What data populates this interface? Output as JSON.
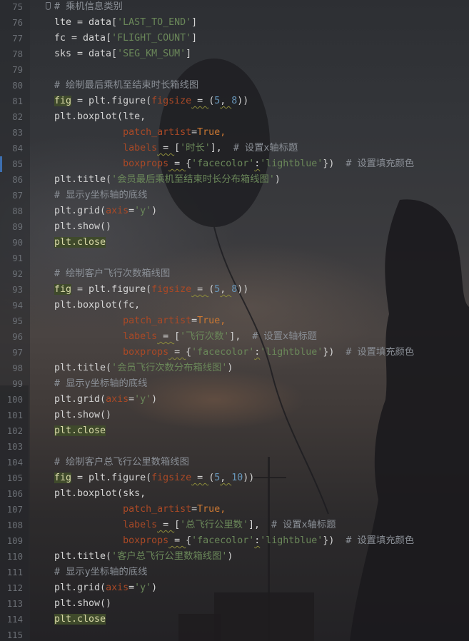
{
  "editor": {
    "lines": [
      {
        "n": "75",
        "segs": [
          {
            "t": "# 乘机信息类别",
            "c": "cm"
          }
        ],
        "fold": true
      },
      {
        "n": "76",
        "segs": [
          {
            "t": "lte = data[",
            "c": ""
          },
          {
            "t": "'LAST_TO_END'",
            "c": "str"
          },
          {
            "t": "]",
            "c": ""
          }
        ]
      },
      {
        "n": "77",
        "segs": [
          {
            "t": "fc = data[",
            "c": ""
          },
          {
            "t": "'FLIGHT_COUNT'",
            "c": "str"
          },
          {
            "t": "]",
            "c": ""
          }
        ]
      },
      {
        "n": "78",
        "segs": [
          {
            "t": "sks = data[",
            "c": ""
          },
          {
            "t": "'SEG_KM_SUM'",
            "c": "str"
          },
          {
            "t": "]",
            "c": ""
          }
        ]
      },
      {
        "n": "79",
        "segs": []
      },
      {
        "n": "80",
        "segs": [
          {
            "t": "# 绘制最后乘机至结束时长箱线图",
            "c": "cm"
          }
        ]
      },
      {
        "n": "81",
        "segs": [
          {
            "t": "fig",
            "c": "hl"
          },
          {
            "t": " = plt.figure(",
            "c": ""
          },
          {
            "t": "figsize",
            "c": "param"
          },
          {
            "t": " = ",
            "c": "sq"
          },
          {
            "t": "(",
            "c": ""
          },
          {
            "t": "5",
            "c": "num"
          },
          {
            "t": ", ",
            "c": "sq"
          },
          {
            "t": "8",
            "c": "num"
          },
          {
            "t": "))",
            "c": ""
          }
        ]
      },
      {
        "n": "82",
        "segs": [
          {
            "t": "plt.boxplot(lte,",
            "c": ""
          }
        ]
      },
      {
        "n": "83",
        "segs": [
          {
            "t": "            ",
            "c": ""
          },
          {
            "t": "patch_artist",
            "c": "param"
          },
          {
            "t": "=",
            "c": ""
          },
          {
            "t": "True",
            "c": "kw"
          },
          {
            "t": ",",
            "c": "kw"
          }
        ]
      },
      {
        "n": "84",
        "segs": [
          {
            "t": "            ",
            "c": ""
          },
          {
            "t": "labels",
            "c": "param"
          },
          {
            "t": " = ",
            "c": "sq"
          },
          {
            "t": "[",
            "c": ""
          },
          {
            "t": "'时长'",
            "c": "str"
          },
          {
            "t": "],  ",
            "c": ""
          },
          {
            "t": "# 设置x轴标题",
            "c": "cm"
          }
        ]
      },
      {
        "n": "85",
        "segs": [
          {
            "t": "            ",
            "c": ""
          },
          {
            "t": "boxprops",
            "c": "param"
          },
          {
            "t": " = ",
            "c": "sq"
          },
          {
            "t": "{",
            "c": ""
          },
          {
            "t": "'facecolor'",
            "c": "str"
          },
          {
            "t": ":",
            "c": "sq"
          },
          {
            "t": "'lightblue'",
            "c": "str"
          },
          {
            "t": "})  ",
            "c": ""
          },
          {
            "t": "# 设置填充颜色",
            "c": "cm"
          }
        ],
        "mark": true
      },
      {
        "n": "86",
        "segs": [
          {
            "t": "plt.title(",
            "c": ""
          },
          {
            "t": "'会员最后乘机至结束时长分布箱线图'",
            "c": "str"
          },
          {
            "t": ")",
            "c": ""
          }
        ]
      },
      {
        "n": "87",
        "segs": [
          {
            "t": "# 显示y坐标轴的底线",
            "c": "cm"
          }
        ]
      },
      {
        "n": "88",
        "segs": [
          {
            "t": "plt.grid(",
            "c": ""
          },
          {
            "t": "axis",
            "c": "param"
          },
          {
            "t": "=",
            "c": ""
          },
          {
            "t": "'y'",
            "c": "str"
          },
          {
            "t": ")",
            "c": ""
          }
        ]
      },
      {
        "n": "89",
        "segs": [
          {
            "t": "plt.show()",
            "c": ""
          }
        ]
      },
      {
        "n": "90",
        "segs": [
          {
            "t": "plt.close",
            "c": "hl"
          }
        ]
      },
      {
        "n": "91",
        "segs": []
      },
      {
        "n": "92",
        "segs": [
          {
            "t": "# 绘制客户飞行次数箱线图",
            "c": "cm"
          }
        ]
      },
      {
        "n": "93",
        "segs": [
          {
            "t": "fig",
            "c": "hl"
          },
          {
            "t": " = plt.figure(",
            "c": ""
          },
          {
            "t": "figsize",
            "c": "param"
          },
          {
            "t": " = ",
            "c": "sq"
          },
          {
            "t": "(",
            "c": ""
          },
          {
            "t": "5",
            "c": "num"
          },
          {
            "t": ", ",
            "c": "sq"
          },
          {
            "t": "8",
            "c": "num"
          },
          {
            "t": "))",
            "c": ""
          }
        ]
      },
      {
        "n": "94",
        "segs": [
          {
            "t": "plt.boxplot(fc,",
            "c": ""
          }
        ]
      },
      {
        "n": "95",
        "segs": [
          {
            "t": "            ",
            "c": ""
          },
          {
            "t": "patch_artist",
            "c": "param"
          },
          {
            "t": "=",
            "c": ""
          },
          {
            "t": "True",
            "c": "kw"
          },
          {
            "t": ",",
            "c": "kw"
          }
        ]
      },
      {
        "n": "96",
        "segs": [
          {
            "t": "            ",
            "c": ""
          },
          {
            "t": "labels",
            "c": "param"
          },
          {
            "t": " = ",
            "c": "sq"
          },
          {
            "t": "[",
            "c": ""
          },
          {
            "t": "'飞行次数'",
            "c": "str"
          },
          {
            "t": "],  ",
            "c": ""
          },
          {
            "t": "# 设置x轴标题",
            "c": "cm"
          }
        ]
      },
      {
        "n": "97",
        "segs": [
          {
            "t": "            ",
            "c": ""
          },
          {
            "t": "boxprops",
            "c": "param"
          },
          {
            "t": " = ",
            "c": "sq"
          },
          {
            "t": "{",
            "c": ""
          },
          {
            "t": "'facecolor'",
            "c": "str"
          },
          {
            "t": ":",
            "c": "sq"
          },
          {
            "t": "'lightblue'",
            "c": "str"
          },
          {
            "t": "})  ",
            "c": ""
          },
          {
            "t": "# 设置填充颜色",
            "c": "cm"
          }
        ]
      },
      {
        "n": "98",
        "segs": [
          {
            "t": "plt.title(",
            "c": ""
          },
          {
            "t": "'会员飞行次数分布箱线图'",
            "c": "str"
          },
          {
            "t": ")",
            "c": ""
          }
        ]
      },
      {
        "n": "99",
        "segs": [
          {
            "t": "# 显示y坐标轴的底线",
            "c": "cm"
          }
        ]
      },
      {
        "n": "100",
        "segs": [
          {
            "t": "plt.grid(",
            "c": ""
          },
          {
            "t": "axis",
            "c": "param"
          },
          {
            "t": "=",
            "c": ""
          },
          {
            "t": "'y'",
            "c": "str"
          },
          {
            "t": ")",
            "c": ""
          }
        ]
      },
      {
        "n": "101",
        "segs": [
          {
            "t": "plt.show()",
            "c": ""
          }
        ]
      },
      {
        "n": "102",
        "segs": [
          {
            "t": "plt.close",
            "c": "hl"
          }
        ]
      },
      {
        "n": "103",
        "segs": []
      },
      {
        "n": "104",
        "segs": [
          {
            "t": "# 绘制客户总飞行公里数箱线图",
            "c": "cm"
          }
        ]
      },
      {
        "n": "105",
        "segs": [
          {
            "t": "fig",
            "c": "hl"
          },
          {
            "t": " = plt.figure(",
            "c": ""
          },
          {
            "t": "figsize",
            "c": "param"
          },
          {
            "t": " = ",
            "c": "sq"
          },
          {
            "t": "(",
            "c": ""
          },
          {
            "t": "5",
            "c": "num"
          },
          {
            "t": ", ",
            "c": "sq"
          },
          {
            "t": "10",
            "c": "num"
          },
          {
            "t": "))",
            "c": ""
          }
        ]
      },
      {
        "n": "106",
        "segs": [
          {
            "t": "plt.boxplot(sks,",
            "c": ""
          }
        ]
      },
      {
        "n": "107",
        "segs": [
          {
            "t": "            ",
            "c": ""
          },
          {
            "t": "patch_artist",
            "c": "param"
          },
          {
            "t": "=",
            "c": ""
          },
          {
            "t": "True",
            "c": "kw"
          },
          {
            "t": ",",
            "c": "kw"
          }
        ]
      },
      {
        "n": "108",
        "segs": [
          {
            "t": "            ",
            "c": ""
          },
          {
            "t": "labels",
            "c": "param"
          },
          {
            "t": " = ",
            "c": "sq"
          },
          {
            "t": "[",
            "c": ""
          },
          {
            "t": "'总飞行公里数'",
            "c": "str"
          },
          {
            "t": "],  ",
            "c": ""
          },
          {
            "t": "# 设置x轴标题",
            "c": "cm"
          }
        ]
      },
      {
        "n": "109",
        "segs": [
          {
            "t": "            ",
            "c": ""
          },
          {
            "t": "boxprops",
            "c": "param"
          },
          {
            "t": " = ",
            "c": "sq"
          },
          {
            "t": "{",
            "c": ""
          },
          {
            "t": "'facecolor'",
            "c": "str"
          },
          {
            "t": ":",
            "c": "sq"
          },
          {
            "t": "'lightblue'",
            "c": "str"
          },
          {
            "t": "})  ",
            "c": ""
          },
          {
            "t": "# 设置填充颜色",
            "c": "cm"
          }
        ]
      },
      {
        "n": "110",
        "segs": [
          {
            "t": "plt.title(",
            "c": ""
          },
          {
            "t": "'客户总飞行公里数箱线图'",
            "c": "str"
          },
          {
            "t": ")",
            "c": ""
          }
        ]
      },
      {
        "n": "111",
        "segs": [
          {
            "t": "# 显示y坐标轴的底线",
            "c": "cm"
          }
        ]
      },
      {
        "n": "112",
        "segs": [
          {
            "t": "plt.grid(",
            "c": ""
          },
          {
            "t": "axis",
            "c": "param"
          },
          {
            "t": "=",
            "c": ""
          },
          {
            "t": "'y'",
            "c": "str"
          },
          {
            "t": ")",
            "c": ""
          }
        ]
      },
      {
        "n": "113",
        "segs": [
          {
            "t": "plt.show()",
            "c": ""
          }
        ]
      },
      {
        "n": "114",
        "segs": [
          {
            "t": "plt.close",
            "c": "hl"
          }
        ]
      },
      {
        "n": "115",
        "segs": []
      }
    ]
  },
  "colors": {
    "keyword": "#cc7832",
    "string": "#6a8759",
    "number": "#6897bb",
    "comment": "#8a8f96",
    "param": "#aa4926",
    "highlight_bg": "#3f4a2b"
  }
}
